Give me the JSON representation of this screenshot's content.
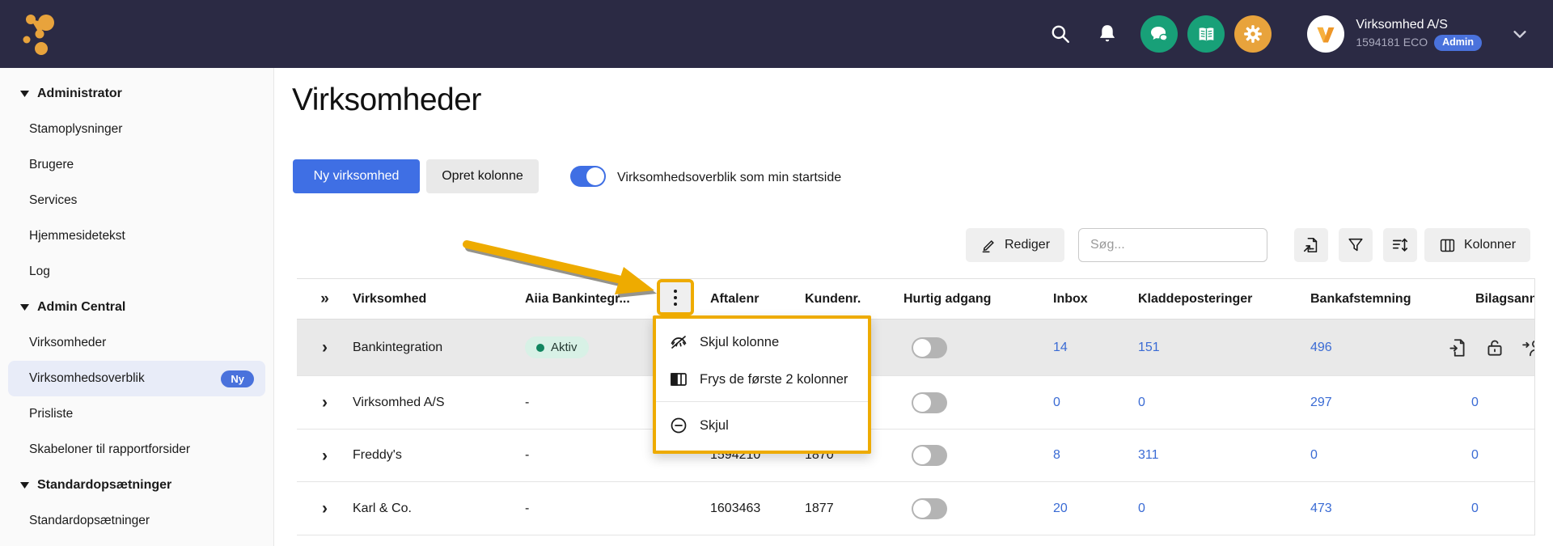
{
  "navbar": {
    "account_name": "Virksomhed A/S",
    "account_id": "1594181 ECO",
    "account_badge": "Admin",
    "icons": [
      "search-icon",
      "bell-icon",
      "chat-icon",
      "book-icon",
      "gear-icon",
      "chevron-down-icon"
    ]
  },
  "sidebar": {
    "sections": [
      {
        "label": "Administrator",
        "items": [
          "Stamoplysninger",
          "Brugere",
          "Services",
          "Hjemmesidetekst",
          "Log"
        ]
      },
      {
        "label": "Admin Central",
        "items": [
          "Virksomheder",
          "Virksomhedsoverblik",
          "Prisliste",
          "Skabeloner til rapportforsider"
        ]
      },
      {
        "label": "Standardopsætninger",
        "items": [
          "Standardopsætninger"
        ]
      }
    ],
    "active_item": "Virksomhedsoverblik",
    "new_badge": "Ny"
  },
  "main": {
    "title": "Virksomheder",
    "buttons": {
      "new_company": "Ny virksomhed",
      "create_column": "Opret kolonne"
    },
    "startpage_toggle": {
      "label": "Virksomhedsoverblik som min startside",
      "state": "on"
    },
    "toolbar": {
      "edit": "Rediger",
      "search_placeholder": "Søg...",
      "columns": "Kolonner"
    }
  },
  "table": {
    "columns": {
      "expand": "»",
      "virksomhed": "Virksomhed",
      "aiia": "Aiia Bankintegr...",
      "aftalenr": "Aftalenr",
      "kundenr": "Kundenr.",
      "hurtig_adgang": "Hurtig adgang",
      "inbox": "Inbox",
      "kladdeposteringer": "Kladdeposteringer",
      "bankafstemning": "Bankafstemning",
      "bilag": "Bilagsann"
    },
    "rows": [
      {
        "name": "Bankintegration",
        "status": "Aktiv",
        "aftalenr": "",
        "kundenr": "",
        "inbox": "14",
        "kladde": "151",
        "bank": "496",
        "bilag": ""
      },
      {
        "name": "Virksomhed A/S",
        "status": "-",
        "aftalenr": "",
        "kundenr": "",
        "inbox": "0",
        "kladde": "0",
        "bank": "297",
        "bilag": "0"
      },
      {
        "name": "Freddy's",
        "status": "-",
        "aftalenr": "1594210",
        "kundenr": "1870",
        "inbox": "8",
        "kladde": "311",
        "bank": "0",
        "bilag": "0"
      },
      {
        "name": "Karl & Co.",
        "status": "-",
        "aftalenr": "1603463",
        "kundenr": "1877",
        "inbox": "20",
        "kladde": "0",
        "bank": "473",
        "bilag": "0"
      }
    ]
  },
  "context_menu": {
    "hide_column": "Skjul kolonne",
    "freeze": "Frys de første 2 kolonner",
    "hide": "Skjul",
    "icons": [
      "eye-off-icon",
      "freeze-columns-icon",
      "minus-circle-icon"
    ]
  },
  "colors": {
    "navbar_bg": "#2b2a44",
    "accent_blue": "#3f6fe4",
    "link_blue": "#3a6bd4",
    "badge_blue": "#4a72dc",
    "green_circle": "#18a078",
    "orange_circle": "#e8a33c",
    "annotation_yellow": "#eeab00",
    "active_status_bg": "#d8f1e6",
    "active_status_dot": "#11855f"
  }
}
